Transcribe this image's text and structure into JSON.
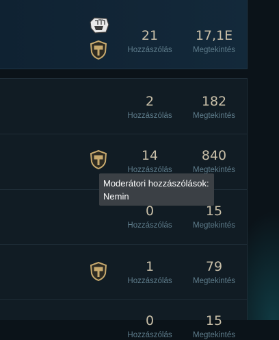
{
  "threads": [
    {
      "comments": "21",
      "comments_label": "Hozzászólás",
      "views": "17,1E",
      "views_label": "Megtekintés",
      "riot_badge": true,
      "moderator_badge": true
    },
    {
      "comments": "2",
      "comments_label": "Hozzászólás",
      "views": "182",
      "views_label": "Megtekintés",
      "riot_badge": false,
      "moderator_badge": false
    },
    {
      "comments": "14",
      "comments_label": "Hozzászólás",
      "views": "840",
      "views_label": "Megtekintés",
      "riot_badge": false,
      "moderator_badge": true
    },
    {
      "comments": "0",
      "comments_label": "Hozzászólás",
      "views": "15",
      "views_label": "Megtekintés",
      "riot_badge": false,
      "moderator_badge": false
    },
    {
      "comments": "1",
      "comments_label": "Hozzászólás",
      "views": "79",
      "views_label": "Megtekintés",
      "riot_badge": false,
      "moderator_badge": true
    },
    {
      "comments": "0",
      "comments_label": "Hozzászólás",
      "views": "15",
      "views_label": "Megtekintés",
      "riot_badge": false,
      "moderator_badge": false
    }
  ],
  "tooltip": {
    "line1": "Moderátori hozzászólások:",
    "line2": "Nemin"
  },
  "colors": {
    "gold": "#c8aa6e",
    "stat_number": "#c9bfa8",
    "stat_label": "#5f7d8c",
    "tooltip_bg": "#3b4045"
  },
  "icons": {
    "riot": "riot-fist-icon",
    "moderator": "moderator-hammer-shield-icon"
  }
}
